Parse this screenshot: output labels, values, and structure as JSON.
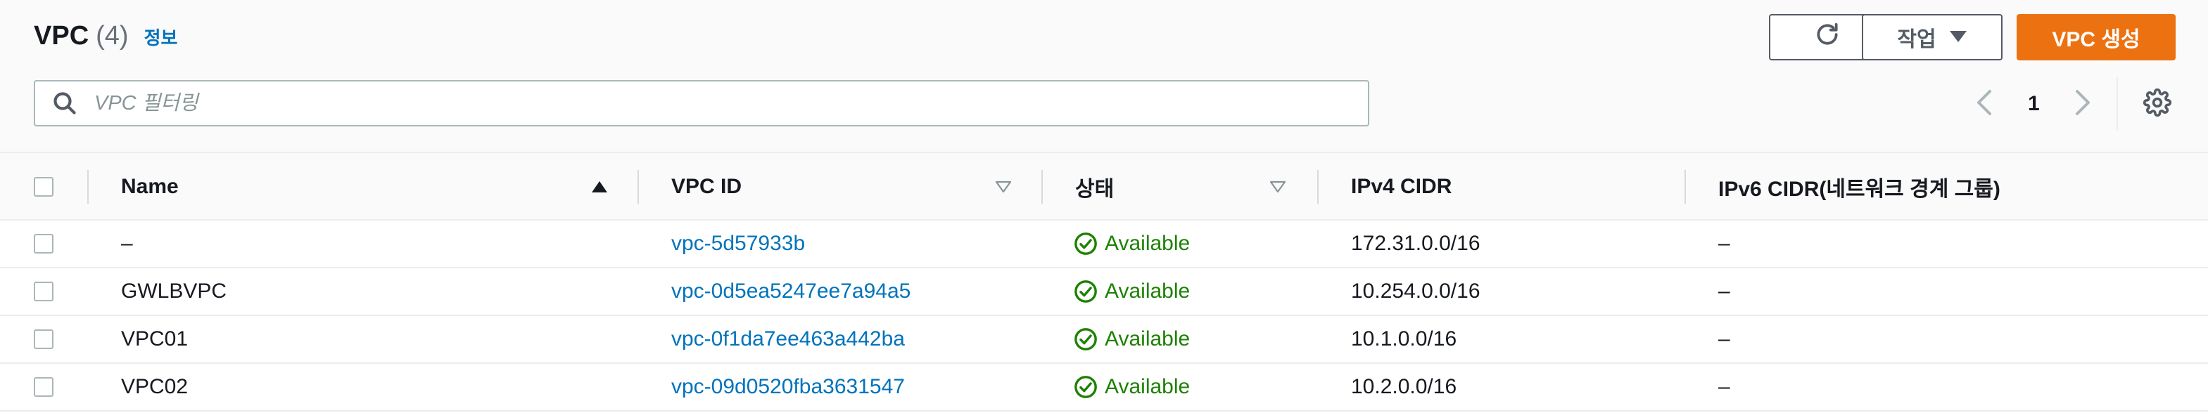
{
  "header": {
    "title": "VPC",
    "count": "(4)",
    "info_link": "정보",
    "actions_label": "작업",
    "create_label": "VPC 생성"
  },
  "search": {
    "placeholder": "VPC 필터링",
    "value": ""
  },
  "pagination": {
    "current_page": "1"
  },
  "table": {
    "columns": {
      "name": "Name",
      "vpc_id": "VPC ID",
      "state": "상태",
      "ipv4": "IPv4 CIDR",
      "ipv6": "IPv6 CIDR(네트워크 경계 그룹)"
    },
    "rows": [
      {
        "name": "–",
        "vpc_id": "vpc-5d57933b",
        "state": "Available",
        "ipv4": "172.31.0.0/16",
        "ipv6": "–"
      },
      {
        "name": "GWLBVPC",
        "vpc_id": "vpc-0d5ea5247ee7a94a5",
        "state": "Available",
        "ipv4": "10.254.0.0/16",
        "ipv6": "–"
      },
      {
        "name": "VPC01",
        "vpc_id": "vpc-0f1da7ee463a442ba",
        "state": "Available",
        "ipv4": "10.1.0.0/16",
        "ipv6": "–"
      },
      {
        "name": "VPC02",
        "vpc_id": "vpc-09d0520fba3631547",
        "state": "Available",
        "ipv4": "10.2.0.0/16",
        "ipv6": "–"
      }
    ]
  },
  "icons": {
    "refresh": "refresh-icon",
    "actions_caret": "caret-down-icon",
    "search": "search-icon",
    "prev": "chevron-left-icon",
    "next": "chevron-right-icon",
    "settings": "gear-icon",
    "sort_asc": "sort-ascending-icon",
    "sort_none": "sort-icon",
    "status": "check-circle-icon"
  },
  "colors": {
    "accent": "#ec7211",
    "link": "#0073bb",
    "success": "#1d8102"
  }
}
